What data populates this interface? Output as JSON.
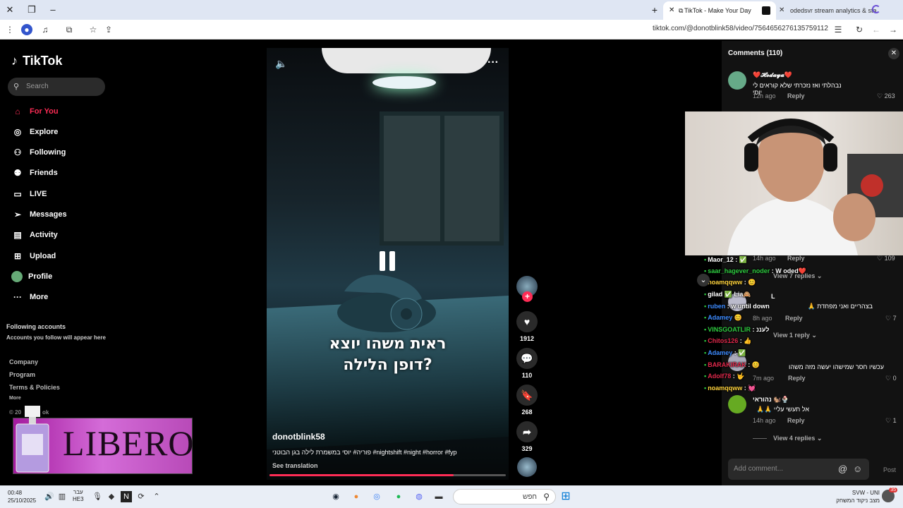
{
  "browser": {
    "tabs": [
      {
        "label": "TikTok - Make Your Day",
        "active": true
      },
      {
        "label": "odedsvr stream analytics & sta",
        "active": false
      }
    ],
    "url": "tiktok.com/@donotblink58/video/7564656276135759112"
  },
  "sidebar": {
    "logo": "TikTok",
    "search_placeholder": "Search",
    "nav": [
      {
        "label": "For You",
        "icon": "home-icon",
        "active": true
      },
      {
        "label": "Explore",
        "icon": "compass-icon",
        "active": false
      },
      {
        "label": "Following",
        "icon": "following-icon",
        "active": false
      },
      {
        "label": "Friends",
        "icon": "friends-icon",
        "active": false
      },
      {
        "label": "LIVE",
        "icon": "live-icon",
        "active": false
      },
      {
        "label": "Messages",
        "icon": "send-icon",
        "active": false
      },
      {
        "label": "Activity",
        "icon": "activity-icon",
        "active": false
      },
      {
        "label": "Upload",
        "icon": "upload-icon",
        "active": false
      },
      {
        "label": "Profile",
        "icon": "profile-avatar-icon",
        "active": false
      },
      {
        "label": "More",
        "icon": "more-icon",
        "active": false
      }
    ],
    "following_accounts_title": "Following accounts",
    "following_accounts_sub": "Accounts you follow will appear here",
    "footer": [
      "Company",
      "Program",
      "Terms & Policies",
      "More"
    ],
    "copyright_fragment_1": "© 20",
    "copyright_fragment_2": "ok"
  },
  "overlay_ad": {
    "brand": "LIBERO"
  },
  "video": {
    "caption": "ראית משהו יוצא\nדופן הלילה?",
    "author": "donotblink58",
    "description": "פוריה# יוסי במשמרת לילה בגן הבוטני #nightshift #night #horror #fyp",
    "see_translation": "See translation",
    "progress_fraction": 0.78
  },
  "actions": {
    "likes": "1912",
    "comments": "110",
    "saves": "268",
    "shares": "329"
  },
  "comments_panel": {
    "title": "Comments (110)",
    "comments": [
      {
        "name": "❤️𝓗𝓸𝓭𝓪𝔂𝓪❤️",
        "text": "נבהלתי ואז נזכרתי שלא קוראים לי יוסי",
        "time": "12h ago",
        "reply": "Reply",
        "likes": "263"
      },
      {
        "time": "14h ago",
        "reply": "Reply",
        "likes": "109",
        "view_replies": "View 7 replies"
      },
      {
        "name": "L",
        "text": "בצהריים ואני מפחדת 🙏",
        "time": "8h ago",
        "reply": "Reply",
        "likes": "7",
        "view_replies": "View 1 reply"
      },
      {
        "text": "עכשיו חסר שמישהו יעשה מזה משהו",
        "time": "7m ago",
        "reply": "Reply",
        "likes": "0"
      },
      {
        "name": "נהוראי 🐿️🍨",
        "text": "אל תעשי עליי 🙏🙏",
        "time": "14h ago",
        "reply": "Reply",
        "likes": "1",
        "view_replies": "View 4 replies"
      }
    ],
    "add_placeholder": "Add comment...",
    "post": "Post"
  },
  "chat": [
    {
      "user": "Maor_12",
      "msg": ": ✅",
      "color": "#ffffff"
    },
    {
      "user": "saar_hagever_noder",
      "msg": ": W oded❤️",
      "color": "#2ecc40"
    },
    {
      "user": "noamqqww",
      "msg": ": 😊",
      "color": "#ffd33d"
    },
    {
      "user": "gilad",
      "msg": "✅ Lia🙈",
      "color": "#ffffff"
    },
    {
      "user": "ruben",
      "msg": ": w until down",
      "color": "#3d8bff"
    },
    {
      "user": "Adamey",
      "msg": "😊",
      "color": "#3d8bff"
    },
    {
      "user": "VINSGOATLIR",
      "msg": ": לעננ",
      "color": "#2ecc40"
    },
    {
      "user": "Chitos126",
      "msg": ": 👍",
      "color": "#e0284b"
    },
    {
      "user": "Adamey",
      "msg": ": ✅",
      "color": "#3d8bff"
    },
    {
      "user": "BARAKIRAK",
      "msg": ": 😊",
      "color": "#e0284b"
    },
    {
      "user": "Adolf78",
      "msg": ": 🤟",
      "color": "#e0284b"
    },
    {
      "user": "noamqqww",
      "msg": ": 💓",
      "color": "#ffd33d"
    }
  ],
  "taskbar": {
    "time": "00:48",
    "date": "25/10/2025",
    "lang_top": "עבר",
    "lang_bottom": "HE3",
    "search_placeholder": "חפש",
    "game_top": "SVW - UNI",
    "game_bottom": "מצב ניקוד המשחק",
    "notif_count": "35"
  }
}
